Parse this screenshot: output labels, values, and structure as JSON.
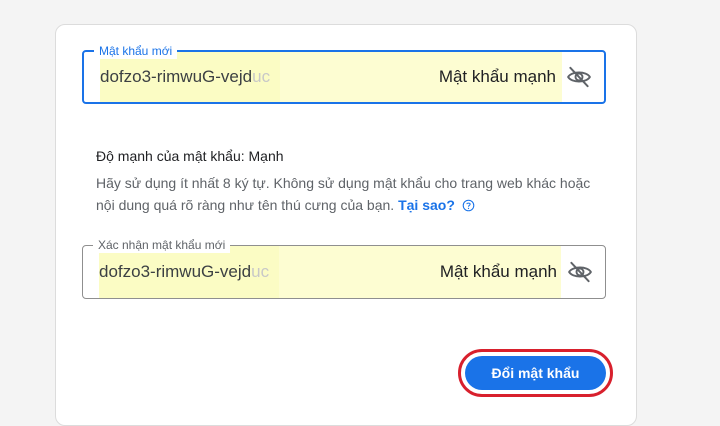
{
  "new_password": {
    "label": "Mật khẩu mới",
    "value_visible": "dofzo3-rimwuG-vejd",
    "value_faded": "uc",
    "strength_badge": "Mật khẩu mạnh",
    "toggle_icon": "eye-off-icon"
  },
  "strength": {
    "title": "Độ mạnh của mật khẩu: Mạnh",
    "hint": "Hãy sử dụng ít nhất 8 ký tự. Không sử dụng mật khẩu cho trang web khác hoặc nội dung quá rõ ràng như tên thú cưng của bạn.",
    "why_link": "Tại sao?",
    "help_icon": "help-circle-icon"
  },
  "confirm_password": {
    "label": "Xác nhận mật khẩu mới",
    "value_visible": "dofzo3-rimwuG-vejd",
    "value_faded": "uc",
    "strength_badge": "Mật khẩu mạnh",
    "toggle_icon": "eye-off-icon"
  },
  "actions": {
    "submit_label": "Đổi mật khẩu"
  },
  "colors": {
    "accent": "#1a73e8",
    "highlight": "#fbfcc4",
    "annotation_red": "#d8202d"
  }
}
